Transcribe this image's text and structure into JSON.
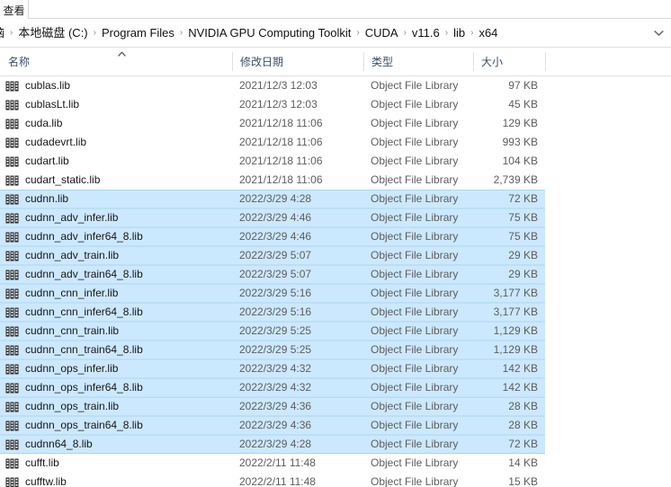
{
  "window": {
    "ribbon_tab_label": "查看",
    "accent_selection_color": "#cce8ff",
    "selection_border_color": "#a8d4f0"
  },
  "address_bar": {
    "dropdown_icon": "chevron-down-icon",
    "separator": "›",
    "crumbs": [
      {
        "label": "脑"
      },
      {
        "label": "本地磁盘 (C:)"
      },
      {
        "label": "Program Files"
      },
      {
        "label": "NVIDIA GPU Computing Toolkit"
      },
      {
        "label": "CUDA"
      },
      {
        "label": "v11.6"
      },
      {
        "label": "lib"
      },
      {
        "label": "x64"
      }
    ]
  },
  "columns": {
    "name": "名称",
    "date_modified": "修改日期",
    "type": "类型",
    "size": "大小",
    "sort_caret": "⌃"
  },
  "files": [
    {
      "name": "cublas.lib",
      "date": "2021/12/3 12:03",
      "type": "Object File Library",
      "size": "97 KB",
      "selected": false,
      "icon": "library-icon"
    },
    {
      "name": "cublasLt.lib",
      "date": "2021/12/3 12:03",
      "type": "Object File Library",
      "size": "45 KB",
      "selected": false,
      "icon": "library-icon"
    },
    {
      "name": "cuda.lib",
      "date": "2021/12/18 11:06",
      "type": "Object File Library",
      "size": "129 KB",
      "selected": false,
      "icon": "library-icon"
    },
    {
      "name": "cudadevrt.lib",
      "date": "2021/12/18 11:06",
      "type": "Object File Library",
      "size": "993 KB",
      "selected": false,
      "icon": "library-icon"
    },
    {
      "name": "cudart.lib",
      "date": "2021/12/18 11:06",
      "type": "Object File Library",
      "size": "104 KB",
      "selected": false,
      "icon": "library-icon"
    },
    {
      "name": "cudart_static.lib",
      "date": "2021/12/18 11:06",
      "type": "Object File Library",
      "size": "2,739 KB",
      "selected": false,
      "icon": "library-icon"
    },
    {
      "name": "cudnn.lib",
      "date": "2022/3/29 4:28",
      "type": "Object File Library",
      "size": "72 KB",
      "selected": true,
      "icon": "library-icon"
    },
    {
      "name": "cudnn_adv_infer.lib",
      "date": "2022/3/29 4:46",
      "type": "Object File Library",
      "size": "75 KB",
      "selected": true,
      "icon": "library-icon"
    },
    {
      "name": "cudnn_adv_infer64_8.lib",
      "date": "2022/3/29 4:46",
      "type": "Object File Library",
      "size": "75 KB",
      "selected": true,
      "icon": "library-icon"
    },
    {
      "name": "cudnn_adv_train.lib",
      "date": "2022/3/29 5:07",
      "type": "Object File Library",
      "size": "29 KB",
      "selected": true,
      "icon": "library-icon"
    },
    {
      "name": "cudnn_adv_train64_8.lib",
      "date": "2022/3/29 5:07",
      "type": "Object File Library",
      "size": "29 KB",
      "selected": true,
      "icon": "library-icon"
    },
    {
      "name": "cudnn_cnn_infer.lib",
      "date": "2022/3/29 5:16",
      "type": "Object File Library",
      "size": "3,177 KB",
      "selected": true,
      "icon": "library-icon"
    },
    {
      "name": "cudnn_cnn_infer64_8.lib",
      "date": "2022/3/29 5:16",
      "type": "Object File Library",
      "size": "3,177 KB",
      "selected": true,
      "icon": "library-icon"
    },
    {
      "name": "cudnn_cnn_train.lib",
      "date": "2022/3/29 5:25",
      "type": "Object File Library",
      "size": "1,129 KB",
      "selected": true,
      "icon": "library-icon"
    },
    {
      "name": "cudnn_cnn_train64_8.lib",
      "date": "2022/3/29 5:25",
      "type": "Object File Library",
      "size": "1,129 KB",
      "selected": true,
      "icon": "library-icon"
    },
    {
      "name": "cudnn_ops_infer.lib",
      "date": "2022/3/29 4:32",
      "type": "Object File Library",
      "size": "142 KB",
      "selected": true,
      "icon": "library-icon"
    },
    {
      "name": "cudnn_ops_infer64_8.lib",
      "date": "2022/3/29 4:32",
      "type": "Object File Library",
      "size": "142 KB",
      "selected": true,
      "icon": "library-icon"
    },
    {
      "name": "cudnn_ops_train.lib",
      "date": "2022/3/29 4:36",
      "type": "Object File Library",
      "size": "28 KB",
      "selected": true,
      "icon": "library-icon"
    },
    {
      "name": "cudnn_ops_train64_8.lib",
      "date": "2022/3/29 4:36",
      "type": "Object File Library",
      "size": "28 KB",
      "selected": true,
      "icon": "library-icon"
    },
    {
      "name": "cudnn64_8.lib",
      "date": "2022/3/29 4:28",
      "type": "Object File Library",
      "size": "72 KB",
      "selected": true,
      "icon": "library-icon"
    },
    {
      "name": "cufft.lib",
      "date": "2022/2/11 11:48",
      "type": "Object File Library",
      "size": "14 KB",
      "selected": false,
      "icon": "library-icon"
    },
    {
      "name": "cufftw.lib",
      "date": "2022/2/11 11:48",
      "type": "Object File Library",
      "size": "15 KB",
      "selected": false,
      "icon": "library-icon"
    }
  ]
}
